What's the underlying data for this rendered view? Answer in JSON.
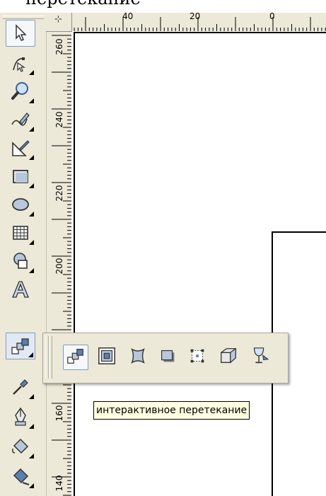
{
  "caption": "перетекание",
  "ruler_top": {
    "labels": [
      "40",
      "20",
      "0"
    ]
  },
  "ruler_left": {
    "labels": [
      "260",
      "240",
      "220",
      "200",
      "160",
      "140"
    ]
  },
  "ruler_corner_symbol": "⊹",
  "toolbox": {
    "tools": [
      {
        "name": "pick-tool",
        "icon": "arrow-pointer-icon",
        "selected": true
      },
      {
        "name": "shape-tool",
        "icon": "shape-node-icon"
      },
      {
        "name": "zoom-tool",
        "icon": "magnifier-icon"
      },
      {
        "name": "freehand-tool",
        "icon": "pencil-curve-icon"
      },
      {
        "name": "smart-fill-tool",
        "icon": "ruler-pen-icon"
      },
      {
        "name": "rectangle-tool",
        "icon": "rectangle-icon"
      },
      {
        "name": "ellipse-tool",
        "icon": "ellipse-icon"
      },
      {
        "name": "graph-paper-tool",
        "icon": "grid-icon"
      },
      {
        "name": "basic-shapes-tool",
        "icon": "basic-shapes-icon"
      },
      {
        "name": "text-tool",
        "icon": "letter-a-icon"
      },
      {
        "name": "interactive-blend-tool",
        "icon": "blend-steps-icon",
        "active": true
      },
      {
        "name": "eyedropper-tool",
        "icon": "eyedropper-icon"
      },
      {
        "name": "outline-tool",
        "icon": "pen-nib-icon"
      },
      {
        "name": "fill-tool",
        "icon": "paint-bucket-icon"
      },
      {
        "name": "interactive-fill-tool",
        "icon": "fill-bucket-icon"
      }
    ]
  },
  "flyout": {
    "tools": [
      {
        "name": "blend",
        "icon": "blend-steps-icon",
        "selected": true
      },
      {
        "name": "contour",
        "icon": "contour-squares-icon"
      },
      {
        "name": "distort",
        "icon": "distort-icon"
      },
      {
        "name": "drop-shadow",
        "icon": "drop-shadow-icon"
      },
      {
        "name": "envelope",
        "icon": "envelope-nodes-icon"
      },
      {
        "name": "extrude",
        "icon": "extrude-cube-icon"
      },
      {
        "name": "transparency",
        "icon": "transparency-glass-icon"
      }
    ]
  },
  "tooltip": {
    "text": "интерактивное перетекание"
  },
  "colors": {
    "toolbar_bg": "#ece9d8",
    "tooltip_bg": "#ffffe1",
    "selected_border": "#7f9db9"
  }
}
